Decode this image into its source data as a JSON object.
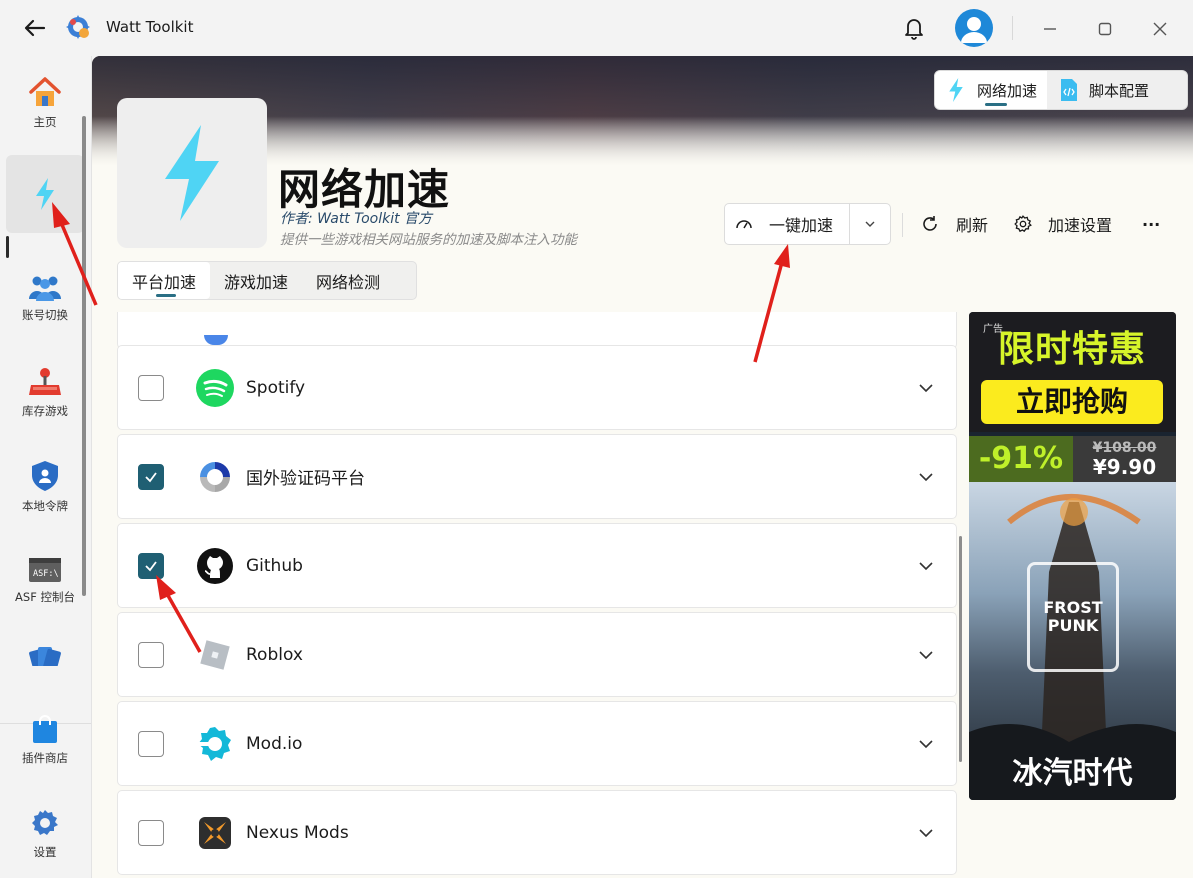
{
  "window": {
    "title": "Watt Toolkit"
  },
  "sidebar": {
    "items": [
      {
        "label": "主页",
        "icon": "home-icon"
      },
      {
        "label": "",
        "icon": "lightning-icon"
      },
      {
        "label": "账号切换",
        "icon": "users-icon"
      },
      {
        "label": "库存游戏",
        "icon": "joystick-icon"
      },
      {
        "label": "本地令牌",
        "icon": "shield-icon"
      },
      {
        "label": "ASF 控制台",
        "icon": "asf-console-icon"
      },
      {
        "label": "插件商店",
        "icon": "shopping-bag-icon"
      },
      {
        "label": "设置",
        "icon": "gear-icon"
      }
    ],
    "asf_badge": "ASF:\\"
  },
  "top_tabs": [
    {
      "label": "网络加速",
      "active": true
    },
    {
      "label": "脚本配置",
      "active": false
    }
  ],
  "header": {
    "title": "网络加速",
    "author": "作者:  Watt Toolkit  官方",
    "description": "提供一些游戏相关网站服务的加速及脚本注入功能"
  },
  "toolbar": {
    "accelerate_label": "一键加速",
    "refresh_label": "刷新",
    "settings_label": "加速设置",
    "more_label": "···"
  },
  "sub_tabs": [
    {
      "label": "平台加速",
      "active": true
    },
    {
      "label": "游戏加速",
      "active": false
    },
    {
      "label": "网络检测",
      "active": false
    }
  ],
  "platforms": [
    {
      "name": "Spotify",
      "checked": false,
      "icon": "spotify-icon"
    },
    {
      "name": "国外验证码平台",
      "checked": true,
      "icon": "recaptcha-icon"
    },
    {
      "name": "Github",
      "checked": true,
      "icon": "github-icon"
    },
    {
      "name": "Roblox",
      "checked": false,
      "icon": "roblox-icon"
    },
    {
      "name": "Mod.io",
      "checked": false,
      "icon": "modio-icon"
    },
    {
      "name": "Nexus Mods",
      "checked": false,
      "icon": "nexus-mods-icon"
    }
  ],
  "ad": {
    "tag": "广告",
    "headline": "限时特惠",
    "cta": "立即抢购",
    "discount": "-91%",
    "old_price": "¥108.00",
    "new_price": "¥9.90",
    "game_logo": "FROST PUNK",
    "game_name": "冰汽时代"
  },
  "colors": {
    "accent": "#2a6f85",
    "checkbox_checked": "#1f5f73",
    "lightning": "#4fd4f4",
    "annotation_arrow": "#e0201b"
  }
}
